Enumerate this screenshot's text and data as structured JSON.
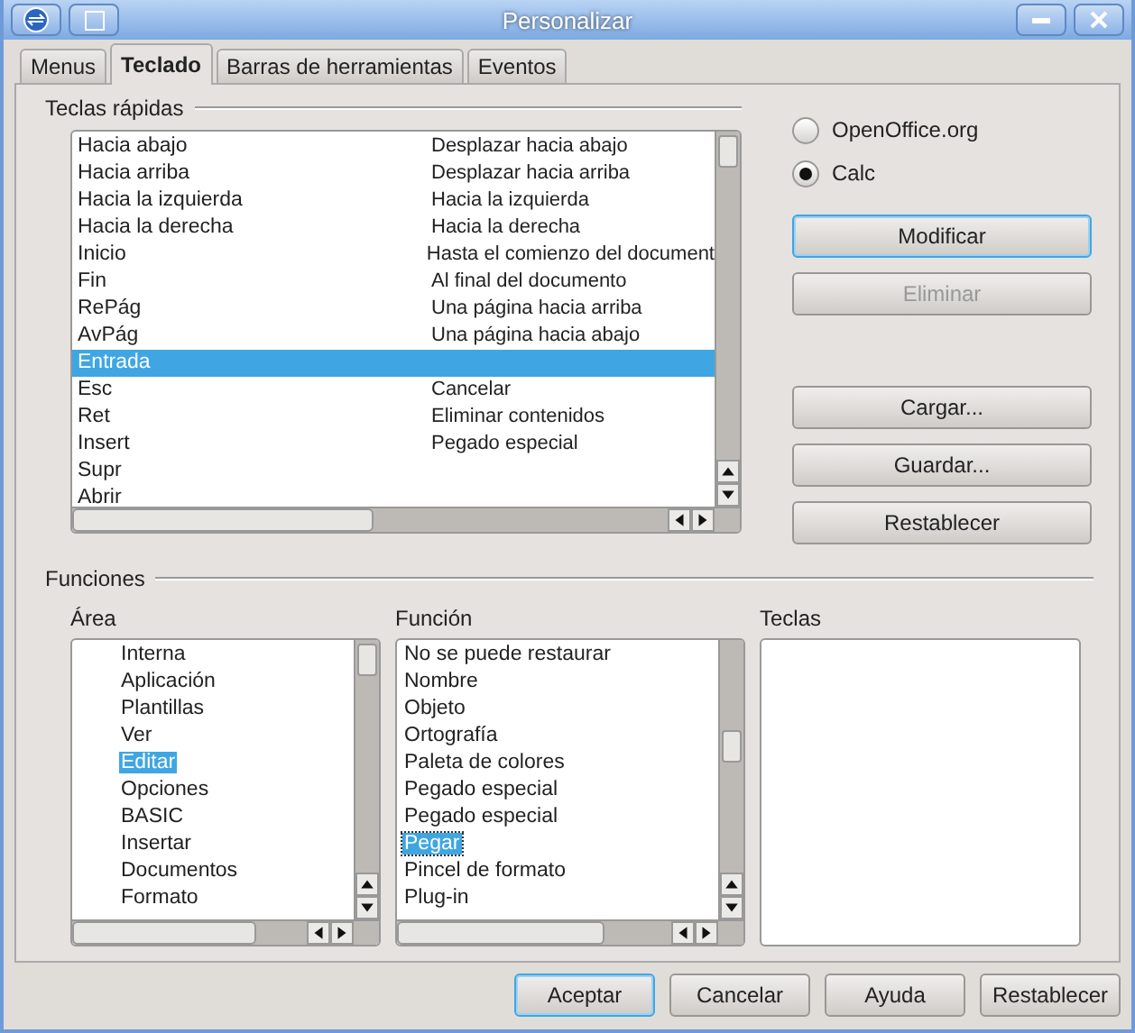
{
  "window": {
    "title": "Personalizar"
  },
  "tabs": [
    {
      "label": "Menus",
      "selected": false
    },
    {
      "label": "Teclado",
      "selected": true
    },
    {
      "label": "Barras de herramientas",
      "selected": false
    },
    {
      "label": "Eventos",
      "selected": false
    }
  ],
  "shortcuts": {
    "title": "Teclas rápidas",
    "rows": [
      {
        "key": "Hacia abajo",
        "command": "Desplazar hacia abajo",
        "selected": false
      },
      {
        "key": "Hacia arriba",
        "command": "Desplazar hacia arriba",
        "selected": false
      },
      {
        "key": "Hacia la izquierda",
        "command": "Hacia la izquierda",
        "selected": false
      },
      {
        "key": "Hacia la derecha",
        "command": "Hacia la derecha",
        "selected": false
      },
      {
        "key": "Inicio",
        "command": "Hasta el comienzo del document",
        "selected": false
      },
      {
        "key": "Fin",
        "command": "Al final del documento",
        "selected": false
      },
      {
        "key": "RePág",
        "command": "Una página hacia arriba",
        "selected": false
      },
      {
        "key": "AvPág",
        "command": "Una página hacia abajo",
        "selected": false
      },
      {
        "key": "Entrada",
        "selected": true
      },
      {
        "key": "Esc",
        "command": "Cancelar",
        "selected": false
      },
      {
        "key": "Ret",
        "command": "Eliminar contenidos",
        "selected": false
      },
      {
        "key": "Insert",
        "command": "Pegado especial",
        "selected": false
      },
      {
        "key": "Supr",
        "selected": false
      },
      {
        "key": "Abrir",
        "selected": false
      }
    ]
  },
  "scope": [
    {
      "label": "OpenOffice.org",
      "selected": false
    },
    {
      "label": "Calc",
      "selected": true
    }
  ],
  "side_buttons": [
    {
      "label": "Modificar",
      "disabled": false,
      "focused": true
    },
    {
      "label": "Eliminar",
      "disabled": true,
      "focused": false
    },
    {
      "label": "Cargar...",
      "disabled": false,
      "focused": false
    },
    {
      "label": "Guardar...",
      "disabled": false,
      "focused": false
    },
    {
      "label": "Restablecer",
      "disabled": false,
      "focused": false
    }
  ],
  "functions": {
    "title": "Funciones",
    "area": {
      "label": "Área",
      "items": [
        {
          "label": "Interna",
          "selected": false
        },
        {
          "label": "Aplicación",
          "selected": false
        },
        {
          "label": "Plantillas",
          "selected": false
        },
        {
          "label": "Ver",
          "selected": false
        },
        {
          "label": "Editar",
          "selected": true
        },
        {
          "label": "Opciones",
          "selected": false
        },
        {
          "label": "BASIC",
          "selected": false
        },
        {
          "label": "Insertar",
          "selected": false
        },
        {
          "label": "Documentos",
          "selected": false
        },
        {
          "label": "Formato",
          "selected": false
        }
      ]
    },
    "function": {
      "label": "Función",
      "items": [
        {
          "label": "No se puede restaurar",
          "selected": false
        },
        {
          "label": "Nombre",
          "selected": false
        },
        {
          "label": "Objeto",
          "selected": false
        },
        {
          "label": "Ortografía",
          "selected": false
        },
        {
          "label": "Paleta de colores",
          "selected": false
        },
        {
          "label": "Pegado especial",
          "selected": false
        },
        {
          "label": "Pegado especial",
          "selected": false
        },
        {
          "label": "Pegar",
          "selected": true
        },
        {
          "label": "Pincel de formato",
          "selected": false
        },
        {
          "label": "Plug-in",
          "selected": false
        }
      ]
    },
    "keys": {
      "label": "Teclas"
    }
  },
  "footer_buttons": [
    {
      "label": "Aceptar",
      "focused": true
    },
    {
      "label": "Cancelar",
      "focused": false
    },
    {
      "label": "Ayuda",
      "focused": false
    },
    {
      "label": "Restablecer",
      "focused": false
    }
  ]
}
